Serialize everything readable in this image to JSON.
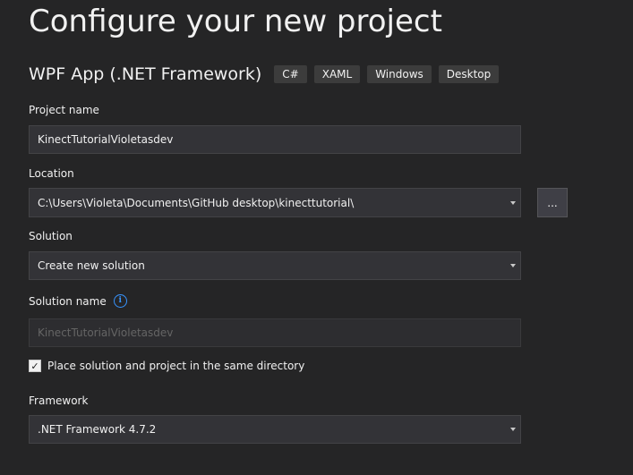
{
  "page": {
    "title": "Configure your new project"
  },
  "template": {
    "name": "WPF App (.NET Framework)",
    "tags": [
      "C#",
      "XAML",
      "Windows",
      "Desktop"
    ]
  },
  "project_name": {
    "label": "Project name",
    "value": "KinectTutorialVioletasdev"
  },
  "location": {
    "label": "Location",
    "value": "C:\\Users\\Violeta\\Documents\\GitHub desktop\\kinecttutorial\\",
    "browse_label": "..."
  },
  "solution": {
    "label": "Solution",
    "value": "Create new solution"
  },
  "solution_name": {
    "label": "Solution name",
    "value": "KinectTutorialVioletasdev",
    "info_glyph": "i"
  },
  "same_directory": {
    "label": "Place solution and project in the same directory",
    "checked": true,
    "check_glyph": "✓"
  },
  "framework": {
    "label": "Framework",
    "value": ".NET Framework 4.7.2"
  },
  "colors": {
    "background": "#252526",
    "field": "#333337",
    "accent": "#3794ff"
  }
}
